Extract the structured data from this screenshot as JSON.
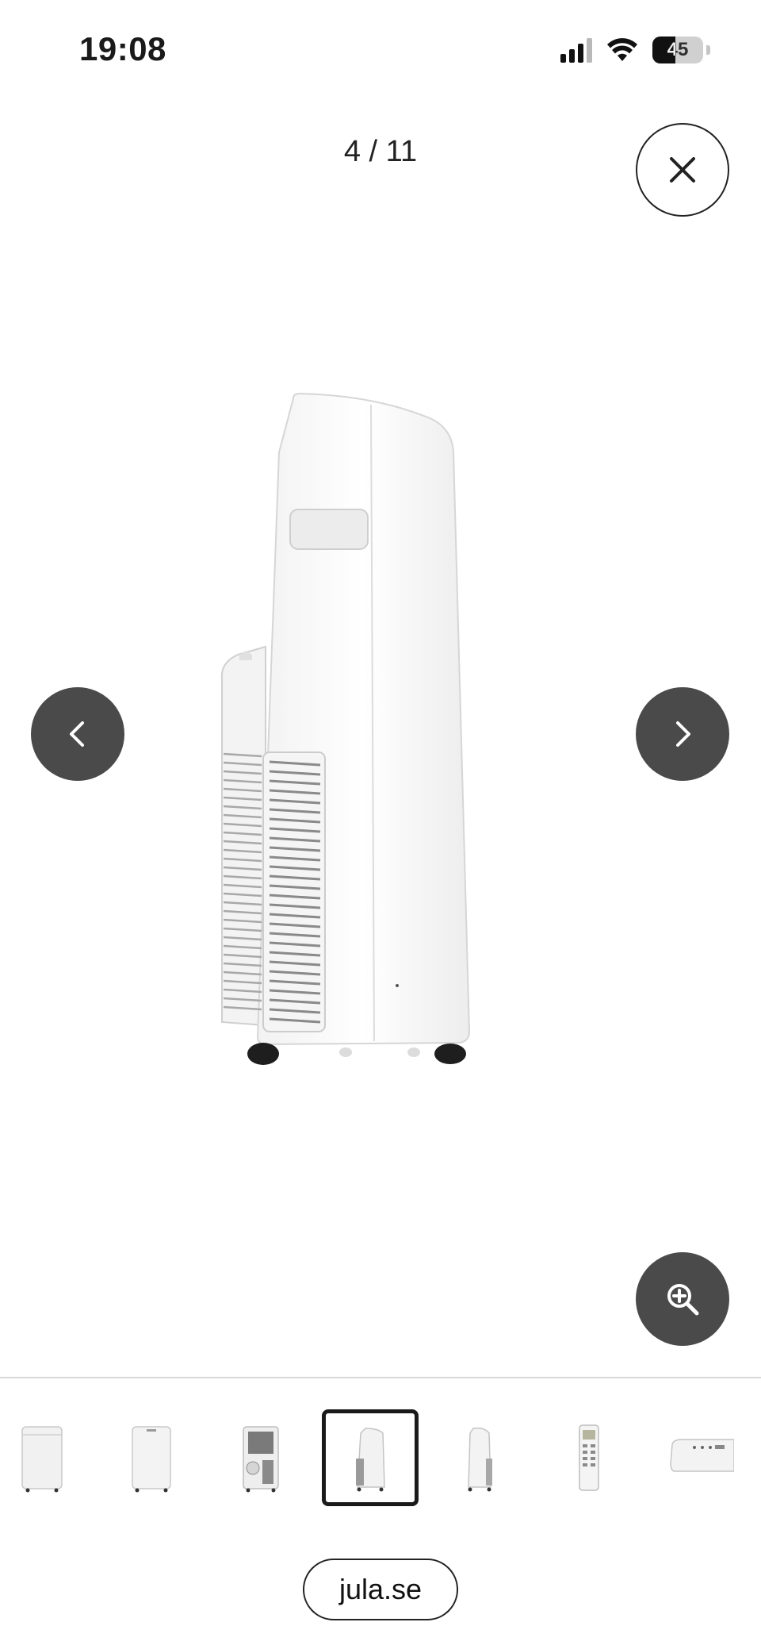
{
  "status_bar": {
    "time": "19:08",
    "battery_level": "45",
    "battery_fraction": 0.45,
    "icons": [
      "cellular-signal-icon",
      "wifi-icon",
      "battery-icon"
    ]
  },
  "gallery": {
    "counter": "4 / 11",
    "current_index": 4,
    "total": 11,
    "icons": {
      "close": "close-icon",
      "prev": "chevron-left-icon",
      "next": "chevron-right-icon",
      "zoom": "zoom-in-icon"
    }
  },
  "thumbnails": [
    {
      "view": "front",
      "selected": false
    },
    {
      "view": "front-angled",
      "selected": false
    },
    {
      "view": "back",
      "selected": false
    },
    {
      "view": "side-left",
      "selected": true
    },
    {
      "view": "side-right",
      "selected": false
    },
    {
      "view": "remote",
      "selected": false
    },
    {
      "view": "top",
      "selected": false
    }
  ],
  "footer": {
    "domain": "jula.se"
  },
  "colors": {
    "button_dark": "#4a4a4a",
    "text": "#1a1a1a",
    "divider": "#d8d8d8",
    "background": "#ffffff"
  }
}
